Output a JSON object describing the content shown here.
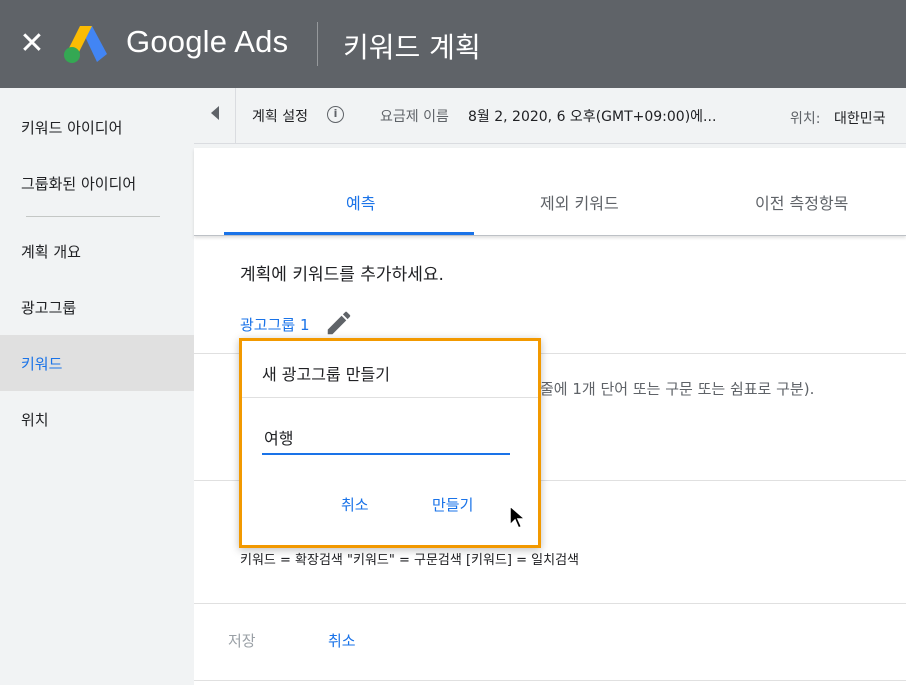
{
  "header": {
    "close_icon": "close-icon",
    "logo_icon": "google-ads-logo",
    "brand": "Google Ads",
    "title": "키워드 계획"
  },
  "sidebar": {
    "items": [
      {
        "label": "키워드 아이디어",
        "active": false
      },
      {
        "label": "그룹화된 아이디어",
        "active": false
      },
      {
        "label": "계획 개요",
        "active": false
      },
      {
        "label": "광고그룹",
        "active": false
      },
      {
        "label": "키워드",
        "active": true
      },
      {
        "label": "위치",
        "active": false
      }
    ]
  },
  "settings": {
    "label": "계획 설정",
    "info_icon": "info-icon",
    "plan_name_key": "요금제 이름",
    "plan_name_value": "8월 2, 2020, 6 오후(GMT+09:00)에...",
    "location_key": "위치:",
    "location_value": "대한민국"
  },
  "tabs": [
    {
      "label": "예측",
      "active": true
    },
    {
      "label": "제외 키워드",
      "active": false
    },
    {
      "label": "이전 측정항목",
      "active": false
    }
  ],
  "content": {
    "heading": "계획에 키워드를 추가하세요.",
    "adgroup_link": "광고그룹 1",
    "pencil_icon": "pencil-icon",
    "hint": "줄에 1개 단어 또는 구문 또는 쉼표로 구분).",
    "exclaim": "!",
    "match_types": "키워드 = 확장검색  \"키워드\" = 구문검색  [키워드] = 일치검색",
    "save": "저장",
    "cancel": "취소"
  },
  "dialog": {
    "title": "새 광고그룹 만들기",
    "input_value": "여행",
    "cancel": "취소",
    "create": "만들기"
  },
  "colors": {
    "header_bg": "#5f6368",
    "accent": "#1a73e8",
    "highlight_border": "#f29900",
    "sidebar_bg": "#f1f3f4"
  }
}
